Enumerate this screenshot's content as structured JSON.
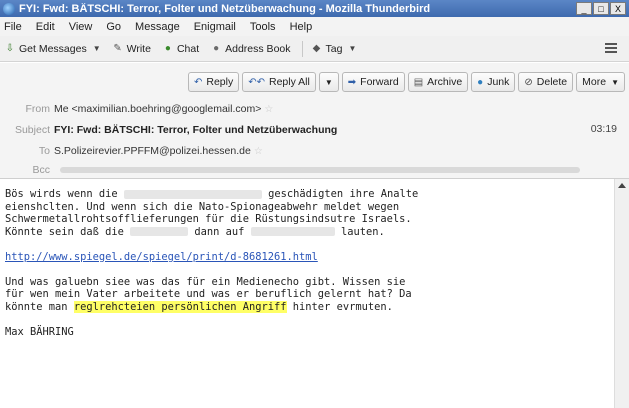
{
  "window": {
    "title": "FYI: Fwd: BÄTSCHI: Terror, Folter und Netzüberwachung - Mozilla Thunderbird",
    "controls": [
      "_",
      "□",
      "X"
    ]
  },
  "menu": [
    "File",
    "Edit",
    "View",
    "Go",
    "Message",
    "Enigmail",
    "Tools",
    "Help"
  ],
  "toolbar": {
    "get_messages": "Get Messages",
    "write": "Write",
    "chat": "Chat",
    "address_book": "Address Book",
    "tag": "Tag"
  },
  "actions": {
    "reply": "Reply",
    "reply_all": "Reply All",
    "forward": "Forward",
    "archive": "Archive",
    "junk": "Junk",
    "delete": "Delete",
    "more": "More"
  },
  "header": {
    "from_label": "From",
    "from_value": "Me <maximilian.boehring@googlemail.com>",
    "subject_label": "Subject",
    "subject_value": "FYI: Fwd: BÄTSCHI: Terror, Folter und Netzüberwachung",
    "time": "03:19",
    "to_label": "To",
    "to_value": "S.Polizeirevier.PPFFM@polizei.hessen.de",
    "bcc_label": "Bcc"
  },
  "body": {
    "line1a": "Bös wirds wenn die ",
    "line1b": " geschädigten ihre Analte",
    "line2": "eienshclten. Und wenn sich die Nato-Spionageabwehr meldet wegen",
    "line3": "Schwermetallrohtsofflieferungen für die Rüstungsindsutre Israels.",
    "line4a": "Könnte sein daß die ",
    "line4b": " dann auf ",
    "line4c": " lauten.",
    "link": "http://www.spiegel.de/spiegel/print/d-8681261.html",
    "line6": "Und was galuebn siee was das für ein Medienecho gibt. Wissen sie",
    "line7": "für wen mein Vater arbeitete und was er beruflich gelernt hat? Da",
    "line8a": "könnte man ",
    "line8_hl": "reglrehcteien persönlichen Angriff",
    "line8b": " hinter evrmuten.",
    "signature": "Max BÄHRING"
  },
  "colors": {
    "titlebar": "#4a76b8",
    "highlight": "#ffff66",
    "link": "#2a55b8"
  }
}
